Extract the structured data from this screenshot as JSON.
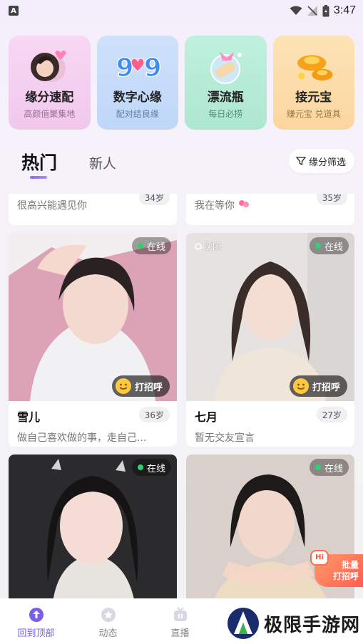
{
  "status_bar": {
    "time": "3:47",
    "app_badge": "A"
  },
  "features": [
    {
      "title": "缘分速配",
      "subtitle": "高颜值聚集地"
    },
    {
      "title": "数字心缘",
      "subtitle": "配对结良缘",
      "art_text": "9♥9"
    },
    {
      "title": "漂流瓶",
      "subtitle": "每日必捞"
    },
    {
      "title": "接元宝",
      "subtitle": "赚元宝 兑道具"
    }
  ],
  "tabs": {
    "hot": "热门",
    "new": "新人"
  },
  "filter": {
    "label": "缘分筛选"
  },
  "feed": {
    "online_label": "在线",
    "greet_label": "打招呼",
    "partial_cards": [
      {
        "name": "",
        "age": "34岁",
        "bio": "很高兴能遇见你"
      },
      {
        "name": "",
        "age": "35岁",
        "bio": "我在等你"
      }
    ],
    "cards": [
      {
        "name": "雪儿",
        "age": "36岁",
        "bio": "做自己喜欢做的事，走自己...",
        "location": ""
      },
      {
        "name": "七月",
        "age": "27岁",
        "bio": "暂无交友宣言",
        "location": "沈阳"
      },
      {
        "name": "",
        "age": "",
        "bio": "",
        "location": ""
      },
      {
        "name": "",
        "age": "",
        "bio": "",
        "location": ""
      }
    ]
  },
  "batch_greet": {
    "line1": "批量",
    "line2": "打招呼",
    "hi": "Hi"
  },
  "bottom_nav": [
    {
      "label": "回到顶部",
      "icon": "arrow-up-icon",
      "active": true
    },
    {
      "label": "动态",
      "icon": "star-icon",
      "active": false
    },
    {
      "label": "直播",
      "icon": "tv-icon",
      "active": false
    }
  ],
  "watermark": {
    "text": "极限手游网"
  },
  "colors": {
    "accent": "#7a5de8",
    "online": "#2fd36b",
    "batch": "#ff6b4f"
  }
}
